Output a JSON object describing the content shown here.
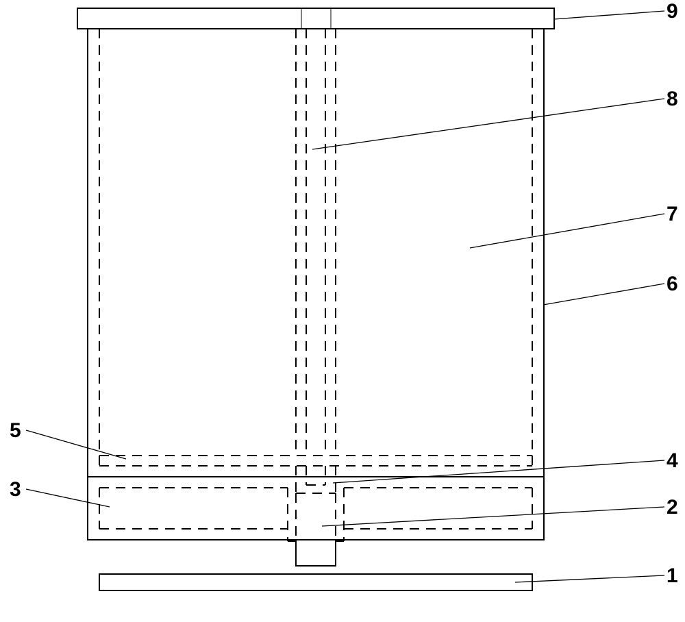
{
  "labels": {
    "l1": "1",
    "l2": "2",
    "l3": "3",
    "l4": "4",
    "l5": "5",
    "l6": "6",
    "l7": "7",
    "l8": "8",
    "l9": "9"
  },
  "diagram": {
    "type": "technical-sectional-drawing",
    "description": "Cylindrical container with base, top flange, central column, and internal dashed hidden lines indicating concentric shells",
    "components": [
      {
        "ref": "1",
        "part": "base-plate"
      },
      {
        "ref": "2",
        "part": "stem-socket"
      },
      {
        "ref": "3",
        "part": "base-housing"
      },
      {
        "ref": "4",
        "part": "central-tube-lower-junction"
      },
      {
        "ref": "5",
        "part": "inner-floor"
      },
      {
        "ref": "6",
        "part": "outer-wall"
      },
      {
        "ref": "7",
        "part": "inner-cavity"
      },
      {
        "ref": "8",
        "part": "central-tube"
      },
      {
        "ref": "9",
        "part": "top-flange"
      }
    ]
  }
}
